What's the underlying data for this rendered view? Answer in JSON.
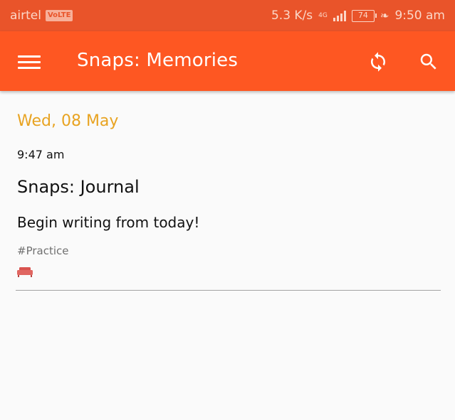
{
  "status_bar": {
    "carrier": "airtel",
    "volte": "VoLTE",
    "speed": "5.3 K/s",
    "network": "4G",
    "battery": "74",
    "time": "9:50 am"
  },
  "app_bar": {
    "title": "Snaps: Memories",
    "menu_icon": "hamburger-menu-icon",
    "sync_icon": "sync-icon",
    "search_icon": "search-icon"
  },
  "entry": {
    "date": "Wed, 08 May",
    "time": "9:47 am",
    "title": "Snaps: Journal",
    "body": "Begin writing from today!",
    "tag": "#Practice",
    "mood_icon": "sofa-icon"
  },
  "colors": {
    "status_bar": "#e9542a",
    "app_bar": "#fe5722",
    "date": "#e8a321",
    "sofa": "#d9534f"
  }
}
